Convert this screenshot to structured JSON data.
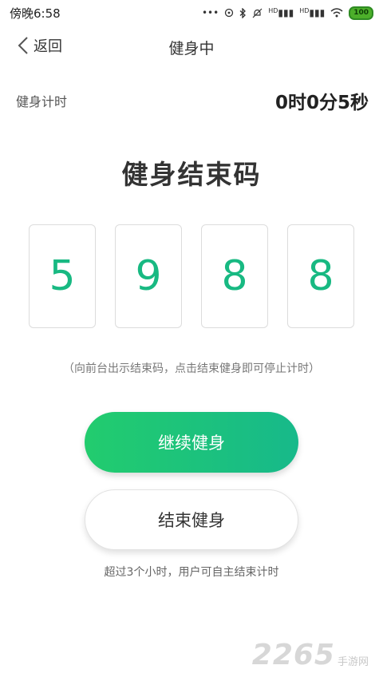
{
  "status_bar": {
    "time": "傍晚6:58",
    "network_label_1": "HD",
    "network_label_2": "HD",
    "battery": "100"
  },
  "nav": {
    "back_label": "返回",
    "title": "健身中"
  },
  "timer": {
    "label": "健身计时",
    "value": "0时0分5秒"
  },
  "code": {
    "title": "健身结束码",
    "digits": [
      "5",
      "9",
      "8",
      "8"
    ],
    "digit_color": "#18b982"
  },
  "hint": "（向前台出示结束码，点击结束健身即可停止计时）",
  "buttons": {
    "continue_label": "继续健身",
    "end_label": "结束健身",
    "continue_color_start": "#22cc6e",
    "continue_color_end": "#17b98a"
  },
  "note": "超过3个小时，用户可自主结束计时",
  "watermark": {
    "number": "2265",
    "site": "手游网"
  }
}
